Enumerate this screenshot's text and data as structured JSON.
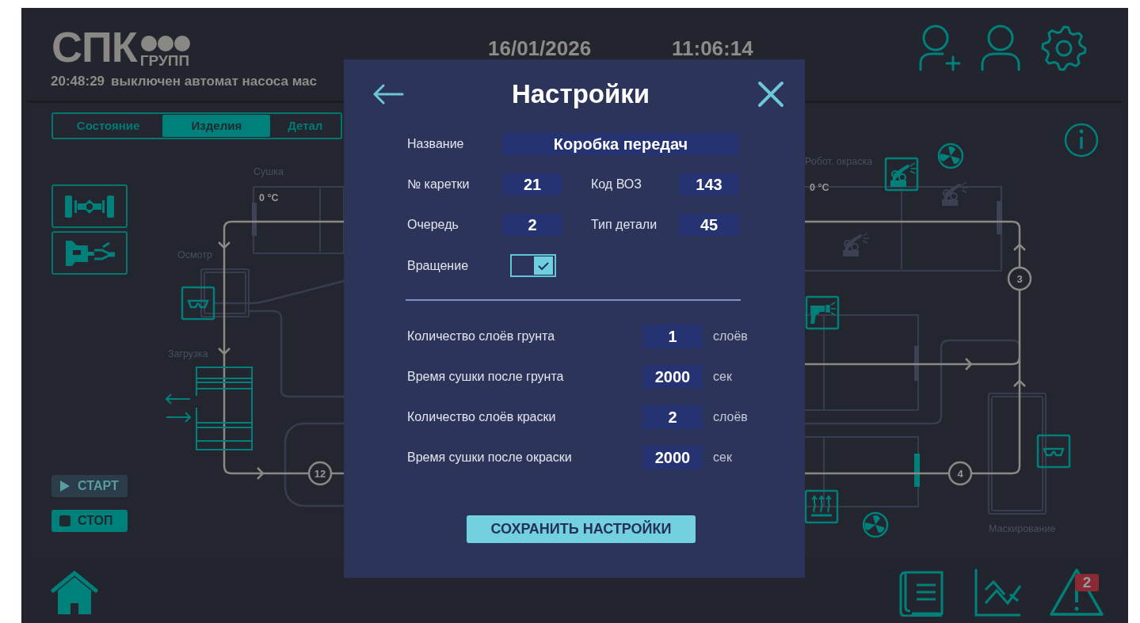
{
  "header": {
    "logo_main": "СПК",
    "logo_sub": "ГРУПП",
    "message_time": "20:48:29",
    "message": "выключен автомат насоса мас",
    "date": "16/01/2026",
    "time": "11:06:14"
  },
  "tabs": [
    {
      "label": "Состояние",
      "selected": false
    },
    {
      "label": "Изделия",
      "selected": true
    },
    {
      "label": "Детал",
      "selected": false
    }
  ],
  "controls": [
    {
      "kind": "start",
      "label": "СТАРТ",
      "disabled": true
    },
    {
      "kind": "stop",
      "label": "СТОП",
      "disabled": false
    }
  ],
  "diagram": {
    "sections": [
      "Сушка",
      "Осмотр",
      "Загрузка",
      "Робот. окраска",
      "Маскирование"
    ],
    "temperatures": [
      "0 °C",
      "0 °C"
    ],
    "positions": [
      "12",
      "3",
      "4"
    ]
  },
  "alarm_badge": "2",
  "dialog": {
    "title": "Настройки",
    "name": {
      "label": "Название",
      "value": "Коробка передач"
    },
    "fields": [
      {
        "label": "№ каретки",
        "value": "21"
      },
      {
        "label": "Код ВОЗ",
        "value": "143"
      },
      {
        "label": "Очередь",
        "value": "2"
      },
      {
        "label": "Тип детали",
        "value": "45"
      }
    ],
    "rotation": {
      "label": "Вращение",
      "checked": true
    },
    "params": [
      {
        "label": "Количество слоёв грунта",
        "value": "1",
        "unit": "слоёв"
      },
      {
        "label": "Время сушки после грунта",
        "value": "2000",
        "unit": "сек"
      },
      {
        "label": "Количество слоёв краски",
        "value": "2",
        "unit": "слоёв"
      },
      {
        "label": "Время сушки после окраски",
        "value": "2000",
        "unit": "сек"
      }
    ],
    "save_button": "СОХРАНИТЬ НАСТРОЙКИ"
  }
}
